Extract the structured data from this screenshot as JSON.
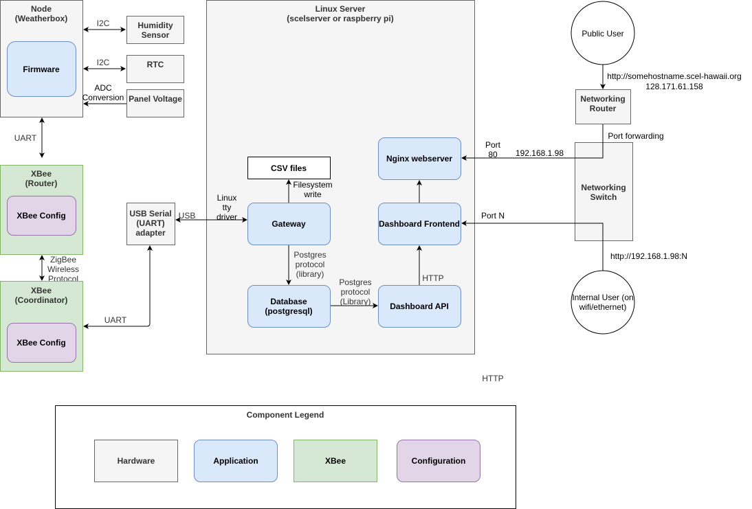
{
  "colors": {
    "hardware": "#f5f5f5",
    "application": "#dae8fc",
    "xbee": "#d5e8d4",
    "configuration": "#e1d5e7"
  },
  "node": {
    "title": [
      "Node",
      "(Weatherbox)"
    ],
    "firmware": "Firmware"
  },
  "peripherals": {
    "humidity": [
      "Humidity",
      "Sensor"
    ],
    "rtc": "RTC",
    "panel": "Panel Voltage"
  },
  "links": {
    "i2c1": "I2C",
    "i2c2": "I2C",
    "adc": [
      "ADC",
      "Conversion"
    ],
    "uart1": "UART",
    "zigbee": [
      "ZigBee",
      "Wireless",
      "Protocol"
    ],
    "uart2": "UART",
    "usb": "USB",
    "tty": [
      "Linux",
      "tty",
      "driver"
    ],
    "fs": [
      "Filesystem",
      "write"
    ],
    "pg1": [
      "Postgres",
      "protocol",
      "(library)"
    ],
    "pg2": [
      "Postgres",
      "protocol",
      "(Library)"
    ],
    "http": "HTTP",
    "port80": [
      "Port",
      "80"
    ],
    "ip": "192.168.1.98",
    "portfwd": "Port forwarding",
    "portn": "Port N",
    "public_url": [
      "http://somehostname.scel-hawaii.org",
      "128.171.61.158"
    ],
    "internal_url": "http://192.168.1.98:N",
    "http_standalone": "HTTP"
  },
  "xbee_router": {
    "title": [
      "XBee",
      "(Router)"
    ],
    "config": "XBee Config"
  },
  "xbee_coord": {
    "title": [
      "XBee",
      "(Coordinator)"
    ],
    "config": "XBee Config"
  },
  "usb_adapter": [
    "USB Serial",
    "(UART)",
    "adapter"
  ],
  "server": {
    "title": [
      "Linux Server",
      "(scelserver or raspberry pi)"
    ],
    "csv": "CSV files",
    "gateway": "Gateway",
    "database": [
      "Database",
      "(postgresql)"
    ],
    "api": "Dashboard API",
    "frontend": "Dashboard Frontend",
    "nginx": "Nginx webserver"
  },
  "network": {
    "public_user": "Public User",
    "router": [
      "Networking",
      "Router"
    ],
    "switch": [
      "Networking",
      "Switch"
    ],
    "internal_user": [
      "Internal User (on",
      "wifi/ethernet)"
    ]
  },
  "legend": {
    "title": "Component Legend",
    "items": [
      "Hardware",
      "Application",
      "XBee",
      "Configuration"
    ]
  }
}
